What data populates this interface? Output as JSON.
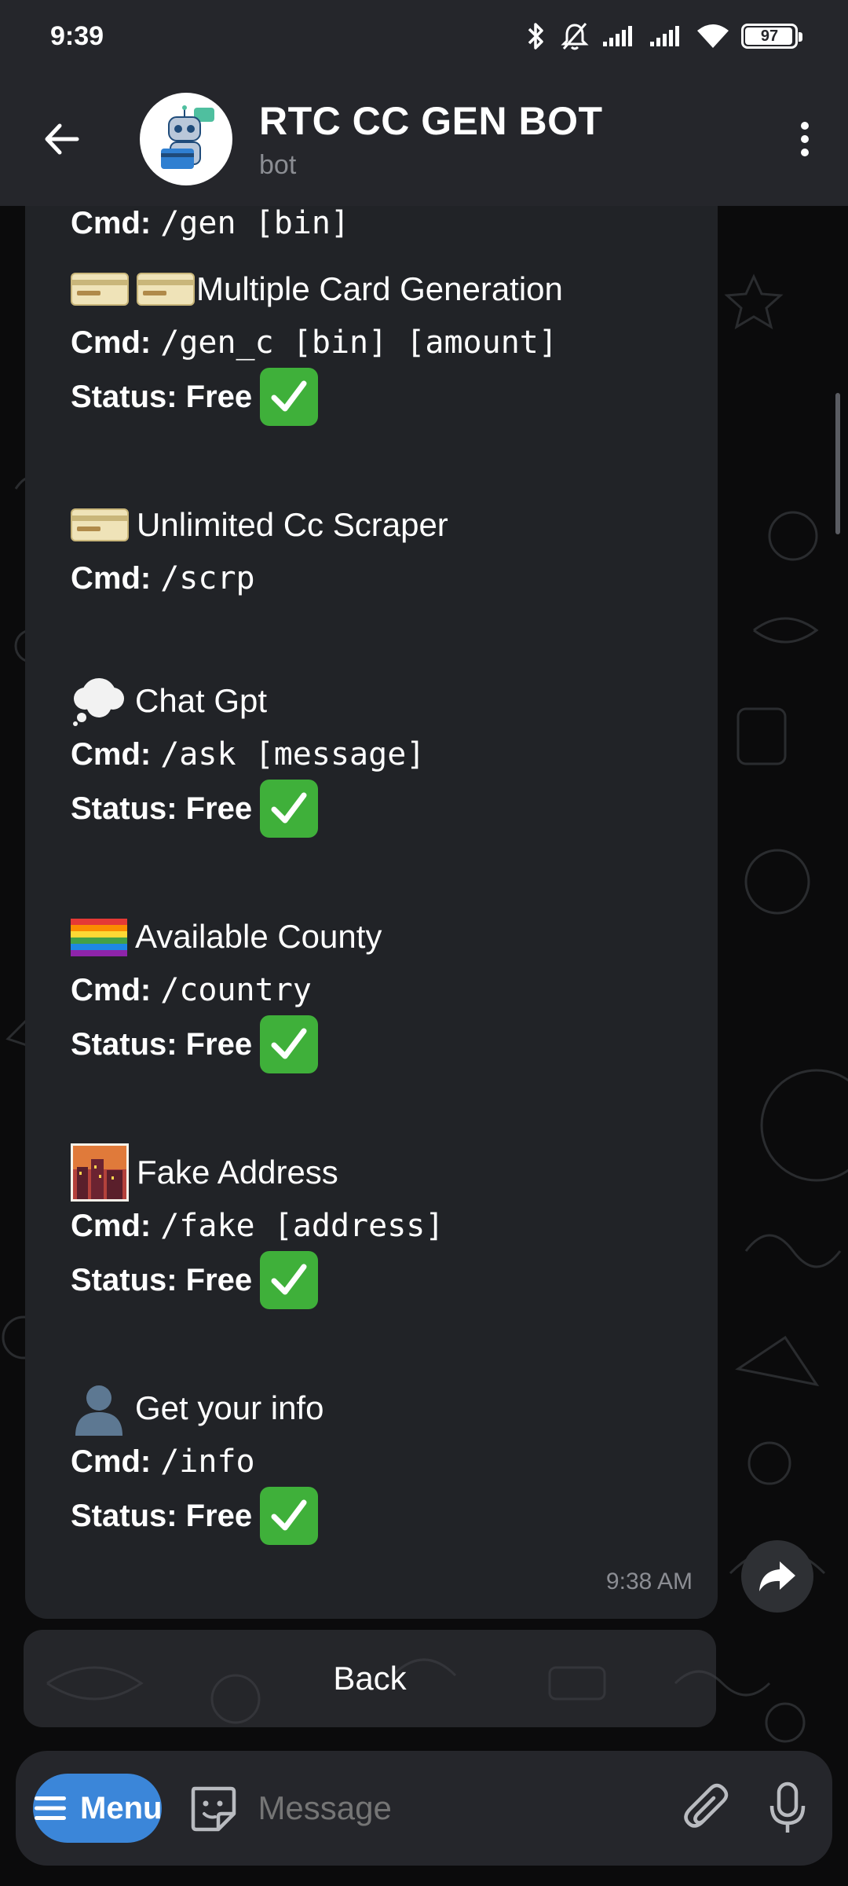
{
  "status_bar": {
    "time": "9:39",
    "battery": "97",
    "battery_level": 0.97,
    "icons": [
      "bluetooth-icon",
      "mute-icon",
      "signal-icon",
      "signal-icon",
      "wifi-icon",
      "battery-icon"
    ]
  },
  "header": {
    "title": "RTC CC GEN BOT",
    "subtitle": "bot"
  },
  "message": {
    "top_line": {
      "label": "Cmd:",
      "code": "/gen [bin]"
    },
    "entries": [
      {
        "icon": "credit-card-icon",
        "icon_count": 2,
        "title": "Multiple Card Generation",
        "cmd_label": "Cmd:",
        "cmd": "/gen_c [bin] [amount]",
        "status": "Status: Free"
      },
      {
        "icon": "credit-card-icon",
        "icon_count": 1,
        "title": "Unlimited Cc Scraper",
        "cmd_label": "Cmd:",
        "cmd": "/scrp",
        "status": ""
      },
      {
        "icon": "thought-bubble-icon",
        "icon_count": 1,
        "title": "Chat Gpt",
        "cmd_label": "Cmd:",
        "cmd": "/ask [message]",
        "status": "Status: Free"
      },
      {
        "icon": "rainbow-flag-icon",
        "icon_count": 1,
        "title": "Available County",
        "cmd_label": "Cmd:",
        "cmd": "/country",
        "status": "Status: Free"
      },
      {
        "icon": "city-dusk-icon",
        "icon_count": 1,
        "title": "Fake Address",
        "cmd_label": "Cmd:",
        "cmd": "/fake [address]",
        "status": "Status: Free"
      },
      {
        "icon": "user-silhouette-icon",
        "icon_count": 1,
        "title": "Get your info",
        "cmd_label": "Cmd:",
        "cmd": "/info",
        "status": "Status: Free"
      }
    ],
    "time": "9:38 AM"
  },
  "keyboard": {
    "back_label": "Back"
  },
  "composer": {
    "menu_label": "Menu",
    "placeholder": "Message"
  },
  "colors": {
    "header_bg": "#25262b",
    "bubble_bg": "#212327",
    "menu_blue": "#3b86d9",
    "check_green": "#3fb03a"
  }
}
